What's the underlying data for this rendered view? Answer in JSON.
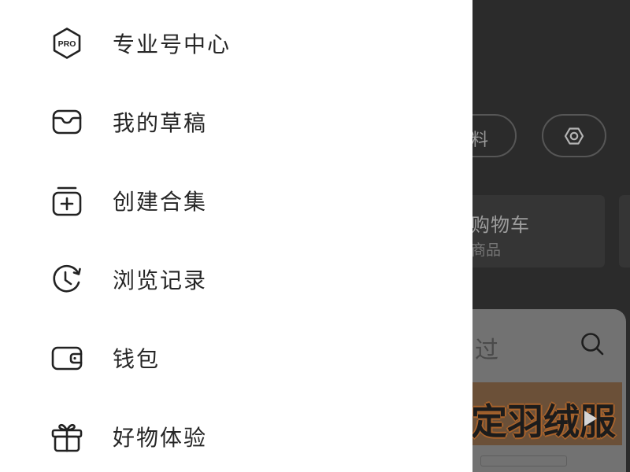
{
  "drawer": {
    "pro_badge_text": "PRO",
    "items": [
      {
        "label": "专业号中心",
        "icon": "pro-badge-icon"
      },
      {
        "label": "我的草稿",
        "icon": "drafts-tray-icon"
      },
      {
        "label": "创建合集",
        "icon": "create-collection-icon"
      },
      {
        "label": "浏览记录",
        "icon": "history-clock-icon"
      },
      {
        "label": "钱包",
        "icon": "wallet-icon"
      },
      {
        "label": "好物体验",
        "icon": "gift-icon"
      }
    ]
  },
  "background_page": {
    "edit_button_label": "料",
    "settings_button_icon": "gear-icon",
    "cart_card": {
      "title": "购物车",
      "subtitle": "商品"
    },
    "search_bar": {
      "text": "过",
      "icon": "search-icon"
    },
    "banner": {
      "text": "定羽绒服",
      "icon": "play-icon"
    }
  },
  "colors": {
    "drawer_background": "#ffffff",
    "menu_text": "#262626",
    "icon_stroke": "#222222",
    "dim_background": "#2b2b2b",
    "dim_card": "#353535",
    "dim_panel": "#727272"
  }
}
